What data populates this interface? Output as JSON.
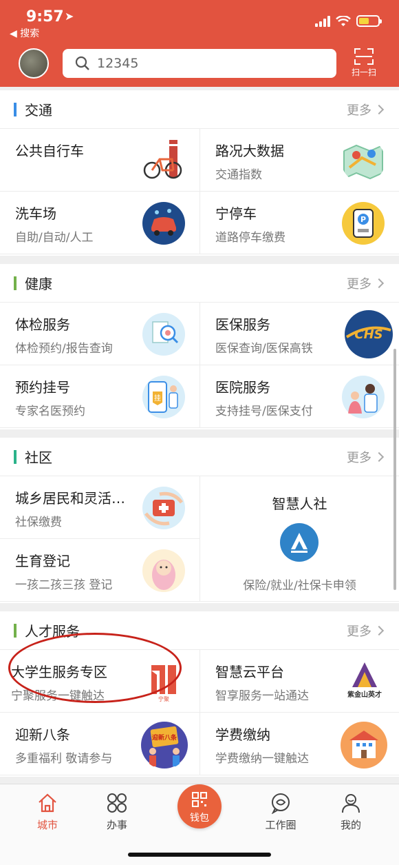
{
  "status": {
    "time": "9:57",
    "back_app": "◀ 搜索"
  },
  "header": {
    "search_value": "12345",
    "scan_label": "扫一扫"
  },
  "colors": {
    "brand": "#e2533f",
    "traffic": "#3a8ee6",
    "health": "#73b14b",
    "community": "#2bb38a",
    "talent": "#73b14b"
  },
  "sections": {
    "traffic": {
      "title": "交通",
      "more": "更多",
      "items": [
        {
          "name": "公共自行车",
          "sub": "",
          "icon": "bicycle-icon"
        },
        {
          "name": "路况大数据",
          "sub": "交通指数",
          "icon": "map-icon"
        },
        {
          "name": "洗车场",
          "sub": "自助/自动/人工",
          "icon": "car-wash-icon"
        },
        {
          "name": "宁停车",
          "sub": "道路停车缴费",
          "icon": "parking-icon"
        }
      ]
    },
    "health": {
      "title": "健康",
      "more": "更多",
      "items": [
        {
          "name": "体检服务",
          "sub": "体检预约/报告查询",
          "icon": "checkup-icon"
        },
        {
          "name": "医保服务",
          "sub": "医保查询/医保高铁",
          "icon": "chs-icon",
          "icon_text": "CHS"
        },
        {
          "name": "预约挂号",
          "sub": "专家名医预约",
          "icon": "registration-icon",
          "icon_text": "挂"
        },
        {
          "name": "医院服务",
          "sub": "支持挂号/医保支付",
          "icon": "hospital-icon"
        }
      ]
    },
    "community": {
      "title": "社区",
      "more": "更多",
      "items": [
        {
          "name": "城乡居民和灵活…",
          "sub": "社保缴费",
          "icon": "medical-kit-icon"
        },
        {
          "name": "生育登记",
          "sub": "一孩二孩三孩 登记",
          "icon": "baby-icon"
        }
      ],
      "big": {
        "name": "智慧人社",
        "sub": "保险/就业/社保卡申领",
        "icon": "human-resources-icon"
      }
    },
    "talent": {
      "title": "人才服务",
      "more": "更多",
      "items": [
        {
          "name": "大学生服务专区",
          "sub": "宁聚服务一键触达",
          "icon": "ningju-icon",
          "icon_text": "宁聚"
        },
        {
          "name": "智慧云平台",
          "sub": "智享服务一站通达",
          "icon": "zijinshan-icon",
          "icon_text": "紫金山英才"
        },
        {
          "name": "迎新八条",
          "sub": "多重福利 敬请参与",
          "icon": "welcome-icon",
          "icon_text": "迎新八条"
        },
        {
          "name": "学费缴纳",
          "sub": "学费缴纳一键触达",
          "icon": "school-icon"
        }
      ]
    }
  },
  "tabbar": {
    "city": "城市",
    "affairs": "办事",
    "wallet": "钱包",
    "moments": "工作圈",
    "mine": "我的"
  }
}
